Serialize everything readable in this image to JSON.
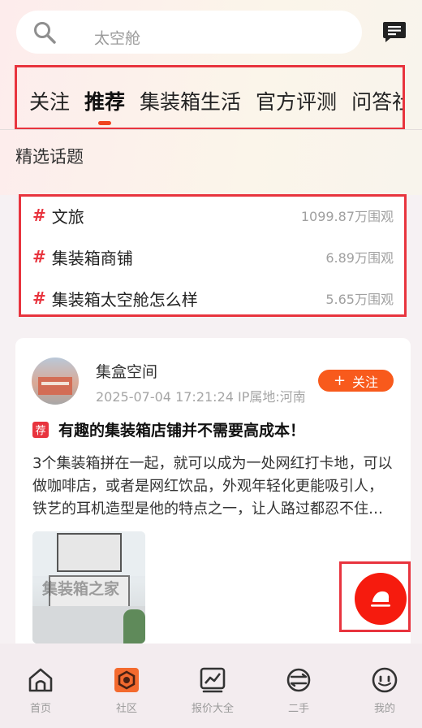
{
  "search": {
    "placeholder": "太空舱"
  },
  "tabs": [
    {
      "label": "关注"
    },
    {
      "label": "推荐",
      "active": true
    },
    {
      "label": "集装箱生活"
    },
    {
      "label": "官方评测"
    },
    {
      "label": "问答社区"
    }
  ],
  "section": {
    "title": "精选话题"
  },
  "topics": [
    {
      "hash": "#",
      "name": "文旅",
      "count": "1099.87万围观"
    },
    {
      "hash": "#",
      "name": "集装箱商铺",
      "count": "6.89万围观"
    },
    {
      "hash": "#",
      "name": "集装箱太空舱怎么样",
      "count": "5.65万围观"
    }
  ],
  "post": {
    "author": "集盒空间",
    "meta": "2025-07-04 17:21:24  IP属地:河南",
    "follow_label": "关注",
    "follow_plus": "+",
    "badge": "荐",
    "title": "有趣的集装箱店铺并不需要高成本！",
    "body": "3个集装箱拼在一起，就可以成为一处网红打卡地，可以做咖啡店，或者是网红饮品，外观年轻化更能吸引人，铁艺的耳机造型是他的特点之一，让人路过都忍不住想进来看看",
    "image_watermark": "集装箱之家"
  },
  "nav": [
    {
      "label": "首页",
      "icon": "home-icon"
    },
    {
      "label": "社区",
      "icon": "community-icon",
      "active": true
    },
    {
      "label": "报价大全",
      "icon": "price-chart-icon"
    },
    {
      "label": "二手",
      "icon": "second-hand-icon"
    },
    {
      "label": "我的",
      "icon": "profile-icon"
    }
  ],
  "colors": {
    "accent": "#f85a1c",
    "highlight_border": "#e8343e",
    "fab": "#f61b0e"
  }
}
